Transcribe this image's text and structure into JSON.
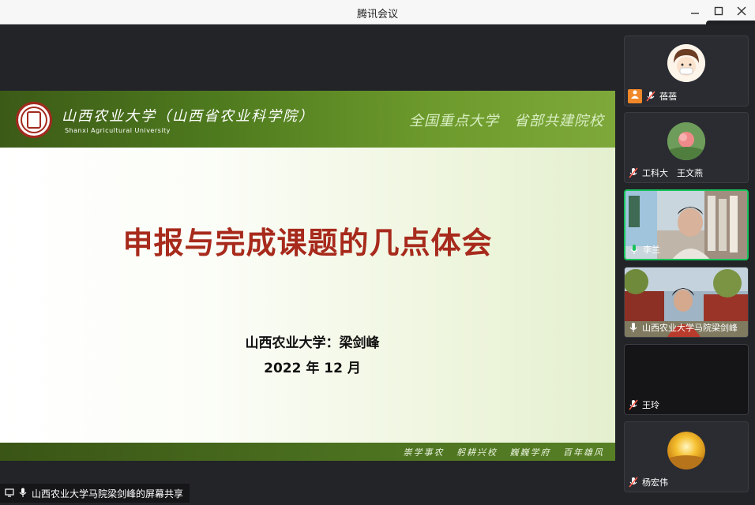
{
  "window": {
    "title": "腾讯会议"
  },
  "slide": {
    "university_name": "山西农业大学（山西省农业科学院）",
    "university_en": "Shanxi Agricultural University",
    "slogan": "全国重点大学　省部共建院校",
    "title": "申报与完成课题的几点体会",
    "author": "山西农业大学：梁剑峰",
    "date": "2022 年 12 月",
    "motto": "崇学事农 躬耕兴校 巍巍学府 百年雄风"
  },
  "share_status": "山西农业大学马院梁剑峰的屏幕共享",
  "speaking_indicator": "正在",
  "participants": [
    {
      "name": "蓓蓓",
      "mic": "muted",
      "has_host_badge": true
    },
    {
      "name": "工科大　王文燕",
      "mic": "muted"
    },
    {
      "name": "李兰",
      "mic": "on"
    },
    {
      "name": "山西农业大学马院梁剑峰",
      "mic": "on"
    },
    {
      "name": "王玲",
      "mic": "muted"
    },
    {
      "name": "杨宏伟",
      "mic": "muted"
    }
  ],
  "colors": {
    "slide_green": "#4e7a1e",
    "title_red": "#a72a1c",
    "active_border": "#16c35a",
    "muted_red": "#ff5a4e"
  },
  "icons": [
    "minimize-icon",
    "maximize-icon",
    "close-icon",
    "microphone-icon",
    "microphone-muted-icon",
    "share-screen-icon",
    "user-icon"
  ]
}
